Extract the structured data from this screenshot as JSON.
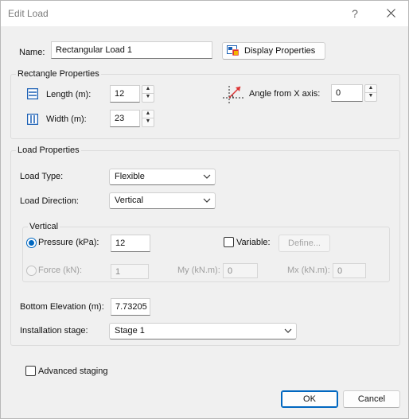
{
  "window": {
    "title": "Edit Load",
    "help_glyph": "?"
  },
  "name": {
    "label": "Name:",
    "value": "Rectangular Load 1"
  },
  "display_properties_button": "Display Properties",
  "rectangle_properties": {
    "title": "Rectangle Properties",
    "length_label": "Length (m):",
    "length_value": "12",
    "width_label": "Width (m):",
    "width_value": "23",
    "angle_label": "Angle from X axis:",
    "angle_value": "0"
  },
  "load_properties": {
    "title": "Load Properties",
    "load_type_label": "Load Type:",
    "load_type_value": "Flexible",
    "load_direction_label": "Load Direction:",
    "load_direction_value": "Vertical",
    "vertical": {
      "title": "Vertical",
      "pressure_label": "Pressure (kPa):",
      "pressure_value": "12",
      "pressure_selected": true,
      "variable_label": "Variable:",
      "variable_checked": false,
      "define_button": "Define...",
      "force_label": "Force (kN):",
      "force_value": "1",
      "my_label": "My (kN.m):",
      "my_value": "0",
      "mx_label": "Mx (kN.m):",
      "mx_value": "0"
    },
    "bottom_elevation_label": "Bottom Elevation (m):",
    "bottom_elevation_value": "7.73205",
    "installation_stage_label": "Installation stage:",
    "installation_stage_value": "Stage 1"
  },
  "advanced_staging": {
    "label": "Advanced staging",
    "checked": false
  },
  "buttons": {
    "ok": "OK",
    "cancel": "Cancel"
  },
  "colors": {
    "accent": "#0067c0",
    "title_text": "#7a7a7a",
    "dialog_bg": "#f0f0f0"
  }
}
